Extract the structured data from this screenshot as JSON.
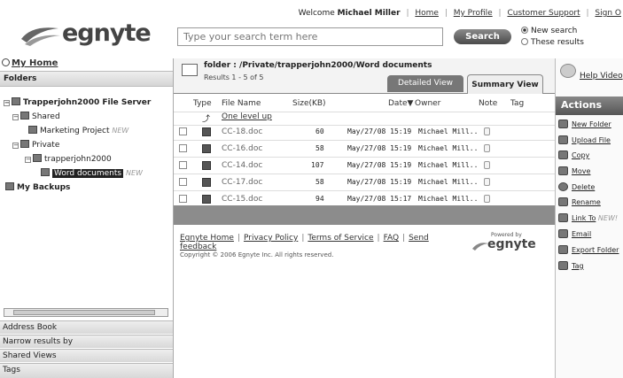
{
  "header": {
    "welcome_prefix": "Welcome",
    "user_name": "Michael Miller",
    "links": [
      "Home",
      "My Profile",
      "Customer Support",
      "Sign O"
    ],
    "logo_text": "egnyte",
    "search_placeholder": "Type your search term here",
    "search_button": "Search",
    "search_options": [
      "New search",
      "These results"
    ],
    "selected_option": "New search"
  },
  "sidebar": {
    "my_home": "My Home",
    "folders_label": "Folders",
    "tree": [
      {
        "label": "Trapperjohn2000 File Server",
        "bold": true
      },
      {
        "label": "Shared"
      },
      {
        "label": "Marketing Project",
        "badge": "NEW"
      },
      {
        "label": "Private"
      },
      {
        "label": "trapperjohn2000"
      },
      {
        "label": "Word documents",
        "badge": "NEW",
        "selected": true
      },
      {
        "label": "My Backups",
        "bold": true
      }
    ],
    "accordions": [
      "Address Book",
      "Narrow results by",
      "Shared Views",
      "Tags"
    ]
  },
  "main": {
    "folder_path": "folder : /Private/trapperjohn2000/Word documents",
    "results_text": "Results 1 - 5 of 5",
    "tabs": [
      "Detailed View",
      "Summary View"
    ],
    "active_tab": "Summary View",
    "columns": [
      "Type",
      "File Name",
      "Size(KB)",
      "Date",
      "Owner",
      "Note",
      "Tag"
    ],
    "up_link": "One level up",
    "files": [
      {
        "name": "CC-18.doc",
        "size": "60",
        "date": "May/27/08 15:19",
        "owner": "Michael Mill.."
      },
      {
        "name": "CC-16.doc",
        "size": "58",
        "date": "May/27/08 15:19",
        "owner": "Michael Mill.."
      },
      {
        "name": "CC-14.doc",
        "size": "107",
        "date": "May/27/08 15:19",
        "owner": "Michael Mill.."
      },
      {
        "name": "CC-17.doc",
        "size": "58",
        "date": "May/27/08 15:19",
        "owner": "Michael Mill.."
      },
      {
        "name": "CC-15.doc",
        "size": "94",
        "date": "May/27/08 15:17",
        "owner": "Michael Mill.."
      }
    ],
    "footer_links": [
      "Egnyte Home",
      "Privacy Policy",
      "Terms of Service",
      "FAQ",
      "Send feedback"
    ],
    "copyright": "Copyright © 2006 Egnyte Inc. All rights reserved.",
    "powered_by": "Powered by",
    "powered_logo": "egnyte"
  },
  "right_panel": {
    "help_label": "Help Video",
    "actions_title": "Actions",
    "actions": [
      {
        "label": "New Folder",
        "icon": "new-folder-icon"
      },
      {
        "label": "Upload File",
        "icon": "upload-icon"
      },
      {
        "label": "Copy",
        "icon": "copy-icon"
      },
      {
        "label": "Move",
        "icon": "move-icon"
      },
      {
        "label": "Delete",
        "icon": "delete-icon"
      },
      {
        "label": "Rename",
        "icon": "rename-icon"
      },
      {
        "label": "Link To",
        "badge": "NEW!",
        "icon": "link-icon"
      },
      {
        "label": "Email",
        "icon": "email-icon"
      },
      {
        "label": "Export Folder",
        "icon": "export-icon"
      },
      {
        "label": "Tag",
        "icon": "tag-icon"
      }
    ]
  }
}
